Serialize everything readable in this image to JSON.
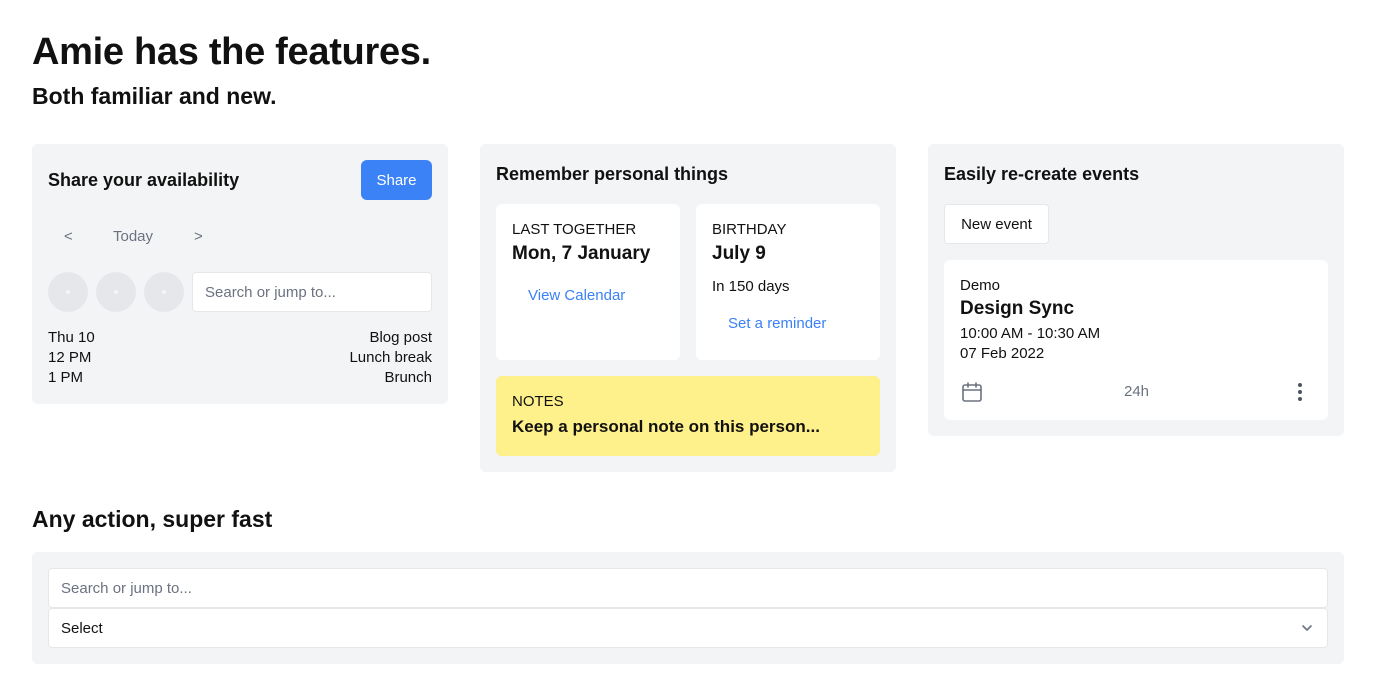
{
  "hero": {
    "title": "Amie has the features.",
    "subtitle": "Both familiar and new."
  },
  "availability": {
    "title": "Share your availability",
    "share_label": "Share",
    "nav": {
      "prev": "<",
      "today": "Today",
      "next": ">"
    },
    "search_placeholder": "Search or jump to...",
    "schedule": [
      {
        "time": "Thu 10",
        "event": "Blog post"
      },
      {
        "time": "12 PM",
        "event": "Lunch break"
      },
      {
        "time": "1 PM",
        "event": "Brunch"
      }
    ]
  },
  "personal": {
    "title": "Remember personal things",
    "last_together": {
      "label": "LAST TOGETHER",
      "value": "Mon, 7 January",
      "link": "View Calendar"
    },
    "birthday": {
      "label": "BIRTHDAY",
      "value": "July 9",
      "sub": "In 150 days",
      "link": "Set a reminder"
    },
    "notes": {
      "label": "NOTES",
      "text": "Keep a personal note on this person..."
    }
  },
  "events": {
    "title": "Easily re-create events",
    "new_event_label": "New event",
    "event": {
      "label": "Demo",
      "title": "Design Sync",
      "time": "10:00 AM - 10:30 AM",
      "date": "07 Feb 2022",
      "duration": "24h",
      "icons": {
        "calendar": "calendar-icon",
        "more": "more-vertical-icon"
      }
    }
  },
  "actions": {
    "title": "Any action, super fast",
    "search_placeholder": "Search or jump to...",
    "select_value": "Select"
  },
  "colors": {
    "accent": "#3b82f6",
    "card_bg": "#f3f4f6",
    "notes_bg": "#fef08a",
    "muted_text": "#6b7280"
  }
}
